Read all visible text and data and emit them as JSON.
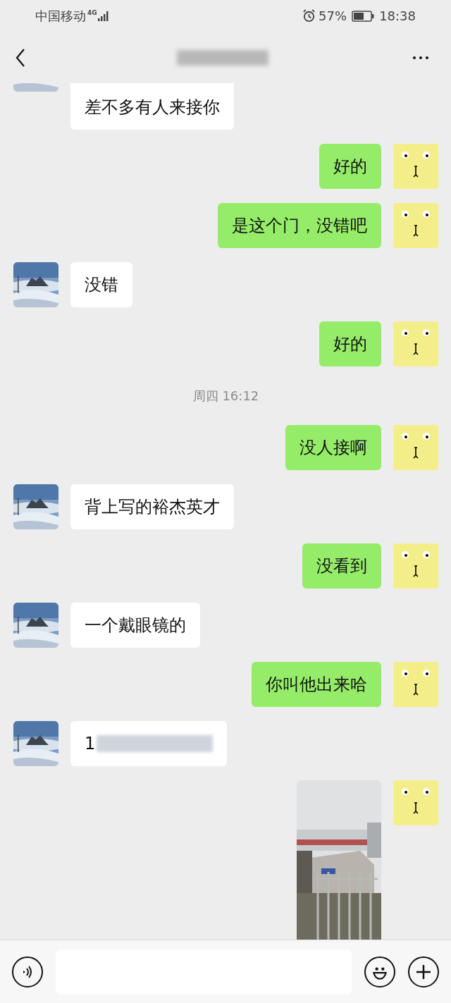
{
  "status_bar": {
    "carrier": "中国移动",
    "network": "4G",
    "battery": "57%",
    "time": "18:38"
  },
  "messages": [
    {
      "kind": "incoming",
      "text": "差不多有人来接你",
      "cut": true
    },
    {
      "kind": "outgoing",
      "text": "好的"
    },
    {
      "kind": "outgoing",
      "text": "是这个门，没错吧"
    },
    {
      "kind": "incoming",
      "text": "没错"
    },
    {
      "kind": "outgoing",
      "text": "好的"
    },
    {
      "kind": "time",
      "text": "周四 16:12"
    },
    {
      "kind": "outgoing",
      "text": "没人接啊"
    },
    {
      "kind": "incoming",
      "text": "背上写的裕杰英才"
    },
    {
      "kind": "outgoing",
      "text": "没看到"
    },
    {
      "kind": "incoming",
      "text": "一个戴眼镜的"
    },
    {
      "kind": "outgoing",
      "text": "你叫他出来哈"
    },
    {
      "kind": "incoming",
      "text": "1",
      "redacted": true
    },
    {
      "kind": "picture"
    }
  ]
}
